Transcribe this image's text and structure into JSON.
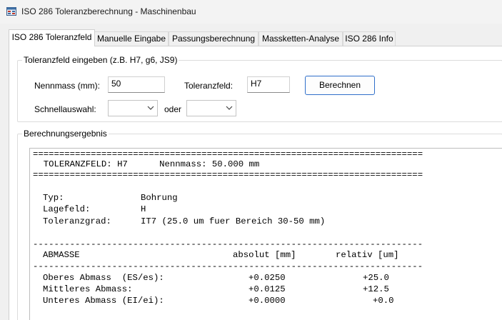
{
  "window": {
    "title": "ISO 286 Toleranzberechnung - Maschinenbau"
  },
  "tabs": [
    {
      "label": "ISO 286 Toleranzfeld",
      "active": true
    },
    {
      "label": "Manuelle Eingabe"
    },
    {
      "label": "Passungsberechnung"
    },
    {
      "label": "Massketten-Analyse"
    },
    {
      "label": "ISO 286 Info"
    }
  ],
  "input_group": {
    "title": "Toleranzfeld eingeben (z.B. H7, g6, JS9)",
    "nennmass_label": "Nennmass (mm):",
    "nennmass_value": "50",
    "toleranzfeld_label": "Toleranzfeld:",
    "toleranzfeld_value": "H7",
    "calc_button": "Berechnen",
    "schnell_label": "Schnellauswahl:",
    "combo1_value": "",
    "oder_label": "oder",
    "combo2_value": ""
  },
  "result_group": {
    "title": "Berechnungsergebnis",
    "separator_double": "==========================================================================",
    "separator_single": "--------------------------------------------------------------------------",
    "header_line": "  TOLERANZFELD: H7      Nennmass: 50.000 mm",
    "info": [
      {
        "key": "Typ:",
        "value": "Bohrung"
      },
      {
        "key": "Lagefeld:",
        "value": "H"
      },
      {
        "key": "Toleranzgrad:",
        "value": "IT7 (25.0 um fuer Bereich 30-50 mm)"
      }
    ],
    "table_headers": {
      "name": "ABMASSE",
      "abs": "absolut [mm]",
      "rel": "relativ [um]"
    },
    "rows": [
      {
        "name": "Oberes Abmass  (ES/es):",
        "abs": "+0.0250",
        "rel": "+25.0"
      },
      {
        "name": "Mittleres Abmass:",
        "abs": "+0.0125",
        "rel": "+12.5"
      },
      {
        "name": "Unteres Abmass (EI/ei):",
        "abs": "+0.0000",
        "rel": "+0.0"
      }
    ]
  },
  "icons": {
    "app": "ruler-grid-icon",
    "dropdown": "chevron-down-icon"
  }
}
